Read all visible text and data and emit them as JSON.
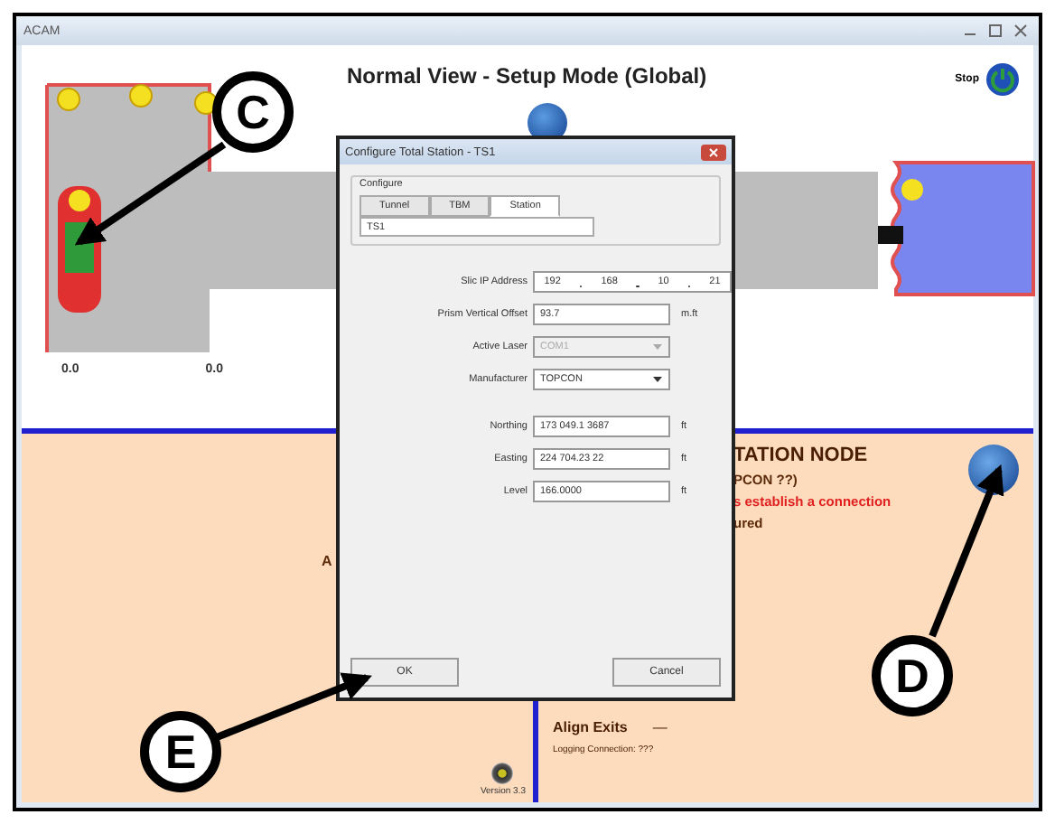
{
  "window": {
    "title": "ACAM"
  },
  "main_view": {
    "title": "Normal View - Setup Mode (Global)",
    "stop_label": "Stop",
    "scale_labels": [
      "0.0",
      "0.0"
    ]
  },
  "left_panel": {
    "fragment": "A",
    "version": "Version 3.3"
  },
  "station_panel": {
    "heading": "TATION NODE",
    "lines": [
      {
        "text": "PCON ??)",
        "kind": "info"
      },
      {
        "text": "s establish a connection",
        "kind": "error"
      },
      {
        "text": "ured",
        "kind": "info"
      }
    ],
    "align_label": "Align Exits",
    "align_value": "—",
    "logging": "Logging Connection: ???"
  },
  "dialog": {
    "title": "Configure Total Station - TS1",
    "group_label": "Configure",
    "tabs": [
      {
        "label": "Tunnel",
        "selected": false
      },
      {
        "label": "TBM",
        "selected": false
      },
      {
        "label": "Station",
        "selected": true
      }
    ],
    "list_item": "TS1",
    "fields": [
      {
        "kind": "ip",
        "label": "Slic IP Address",
        "octets": [
          "192",
          "168",
          "10",
          "21"
        ]
      },
      {
        "kind": "text",
        "label": "Prism Vertical Offset",
        "value": "93.7",
        "unit": "m.ft"
      },
      {
        "kind": "select",
        "label": "Active Laser",
        "value": "COM1",
        "disabled": true
      },
      {
        "kind": "select",
        "label": "Manufacturer",
        "value": "TOPCON",
        "disabled": false
      },
      {
        "kind": "text",
        "label": "Northing",
        "value": "173 049.1 3687",
        "unit": "ft"
      },
      {
        "kind": "text",
        "label": "Easting",
        "value": "224 704.23 22",
        "unit": "ft"
      },
      {
        "kind": "text",
        "label": "Level",
        "value": "166.0000",
        "unit": "ft"
      }
    ],
    "buttons": [
      "OK",
      "Cancel"
    ]
  },
  "callouts": [
    {
      "letter": "C"
    },
    {
      "letter": "D"
    },
    {
      "letter": "E"
    }
  ]
}
